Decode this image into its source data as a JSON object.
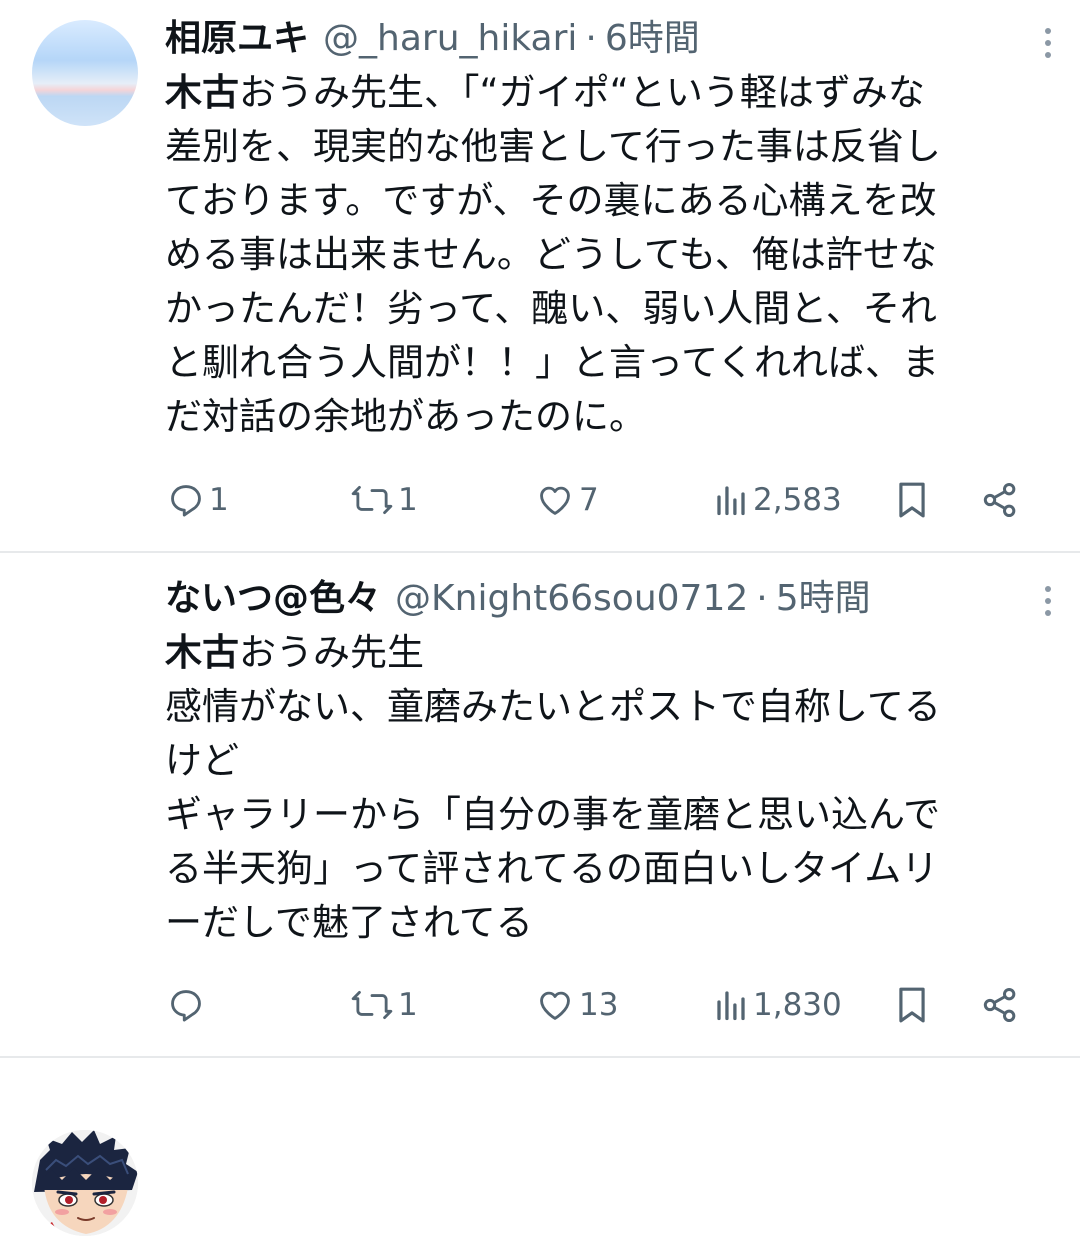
{
  "tweets": [
    {
      "display_name": "相原ユキ",
      "handle": "@_haru_hikari",
      "separator": "·",
      "time": "6時間",
      "mention": "木古",
      "text": "おうみ先生、「“ガイポ“という軽はずみな\n差別を、現実的な他害として行った事は反省し\nております。ですが、その裏にある心構えを改\nめる事は出来ません。どうしても、俺は許せな\nかったんだ！劣って、醜い、弱い人間と、それ\nと馴れ合う人間が！！」と言ってくれれば、ま\nだ対話の余地があったのに。",
      "avatar_icon": "sky-horizon-avatar",
      "stats": {
        "replies": "1",
        "retweets": "1",
        "likes": "7",
        "views": "2,583"
      }
    },
    {
      "display_name": "ないつ@色々",
      "handle": "@Knight66sou0712",
      "separator": "·",
      "time": "5時間",
      "mention": "木古",
      "text": "おうみ先生\n感情がない、童磨みたいとポストで自称してる\nけど\nギャラリーから「自分の事を童磨と思い込んで\nる半天狗」って評されてるの面白いしタイムリ\nーだしで魅了されてる",
      "avatar_icon": "anime-character-avatar",
      "stats": {
        "replies": "",
        "retweets": "1",
        "likes": "13",
        "views": "1,830"
      }
    }
  ],
  "icons": {
    "reply": "reply-icon",
    "retweet": "retweet-icon",
    "like": "heart-icon",
    "views": "views-icon",
    "bookmark": "bookmark-icon",
    "share": "share-icon",
    "more": "more-icon"
  },
  "colors": {
    "text": "#0f1419",
    "secondary": "#536471",
    "divider": "#e7e9eb"
  }
}
